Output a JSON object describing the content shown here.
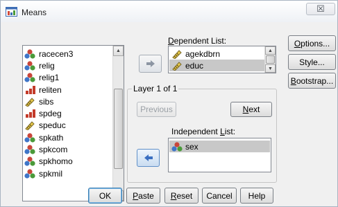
{
  "window": {
    "title": "Means",
    "close_glyph": "☒"
  },
  "source_list": {
    "items": [
      {
        "label": "racecen3",
        "icon": "nominal-icon"
      },
      {
        "label": "relig",
        "icon": "nominal-icon"
      },
      {
        "label": "relig1",
        "icon": "nominal-icon"
      },
      {
        "label": "reliten",
        "icon": "ordinal-icon"
      },
      {
        "label": "sibs",
        "icon": "scale-icon"
      },
      {
        "label": "spdeg",
        "icon": "ordinal-icon"
      },
      {
        "label": "speduc",
        "icon": "scale-icon"
      },
      {
        "label": "spkath",
        "icon": "nominal-icon"
      },
      {
        "label": "spkcom",
        "icon": "nominal-icon"
      },
      {
        "label": "spkhomo",
        "icon": "nominal-icon"
      },
      {
        "label": "spkmil",
        "icon": "nominal-icon"
      }
    ]
  },
  "dependent": {
    "label": "Dependent List:",
    "items": [
      {
        "label": "agekdbrn",
        "icon": "scale-icon"
      },
      {
        "label": "educ",
        "icon": "scale-icon"
      }
    ]
  },
  "layer": {
    "title": "Layer 1 of 1",
    "previous_label": "Previous",
    "next_label": "Next",
    "independent_label": "Independent List:",
    "items": [
      {
        "label": "sex",
        "icon": "nominal-icon"
      }
    ]
  },
  "side_buttons": {
    "options": "Options...",
    "style": "Style...",
    "bootstrap": "Bootstrap..."
  },
  "bottom_buttons": {
    "ok": "OK",
    "paste": "Paste",
    "reset": "Reset",
    "cancel": "Cancel",
    "help": "Help"
  },
  "colors": {
    "nominal_blue": "#3f76c8",
    "nominal_green": "#4a9a3a",
    "nominal_red": "#c8463a",
    "ordinal_red": "#c33b2b",
    "arrow_blue": "#3a6fc1"
  }
}
